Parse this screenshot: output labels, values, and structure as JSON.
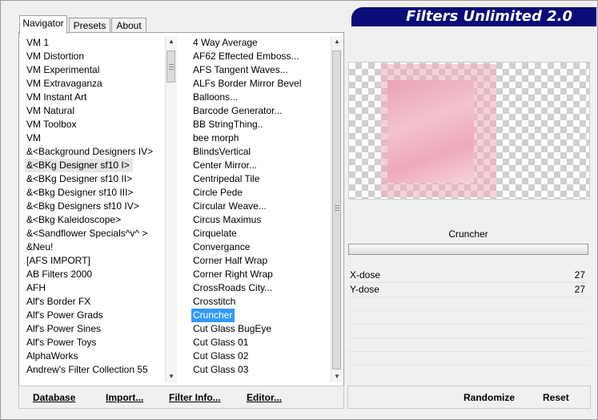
{
  "app": {
    "title": "Filters Unlimited 2.0",
    "title_bg": "#0b0b7a",
    "selection_color": "#3399ff"
  },
  "tabs": [
    {
      "label": "Navigator",
      "active": true
    },
    {
      "label": "Presets",
      "active": false
    },
    {
      "label": "About",
      "active": false
    }
  ],
  "categories": [
    "VM 1",
    "VM Distortion",
    "VM Experimental",
    "VM Extravaganza",
    "VM Instant Art",
    "VM Natural",
    "VM Toolbox",
    "VM",
    "&<Background Designers IV>",
    "&<BKg Designer sf10 I>",
    "&<BKg Designer sf10 II>",
    "&<Bkg Designer sf10 III>",
    "&<Bkg Designers sf10 IV>",
    "&<Bkg Kaleidoscope>",
    "&<Sandflower Specials^v^ >",
    "&Neu!",
    "[AFS IMPORT]",
    "AB Filters 2000",
    "AFH",
    "Alf's Border FX",
    "Alf's Power Grads",
    "Alf's Power Sines",
    "Alf's Power Toys",
    "AlphaWorks",
    "Andrew's Filter Collection 55"
  ],
  "categories_highlight": "&<BKg Designer sf10 I>",
  "filters": [
    "4 Way Average",
    "AF62 Effected Emboss...",
    "AFS Tangent Waves...",
    "ALFs Border Mirror Bevel",
    "Balloons...",
    "Barcode Generator...",
    "BB StringThing..",
    "bee morph",
    "BlindsVertical",
    "Center Mirror...",
    "Centripedal Tile",
    "Circle Pede",
    "Circular Weave...",
    "Circus Maximus",
    "Cirquelate",
    "Convergance",
    "Corner Half Wrap",
    "Corner Right Wrap",
    "CrossRoads City...",
    "Crosstitch",
    "Cruncher",
    "Cut Glass  BugEye",
    "Cut Glass 01",
    "Cut Glass 02",
    "Cut Glass 03"
  ],
  "selected_filter": "Cruncher",
  "left_buttons": {
    "database": "Database",
    "import": "Import...",
    "filter_info": "Filter Info...",
    "editor": "Editor..."
  },
  "right_buttons": {
    "randomize": "Randomize",
    "reset": "Reset"
  },
  "filter_name": "Cruncher",
  "params": [
    {
      "label": "X-dose",
      "value": "27"
    },
    {
      "label": "Y-dose",
      "value": "27"
    }
  ],
  "icons": {
    "scroll_up": "scroll-up-arrow-icon",
    "scroll_down": "scroll-down-arrow-icon",
    "thumb_grip": "grip-icon"
  }
}
